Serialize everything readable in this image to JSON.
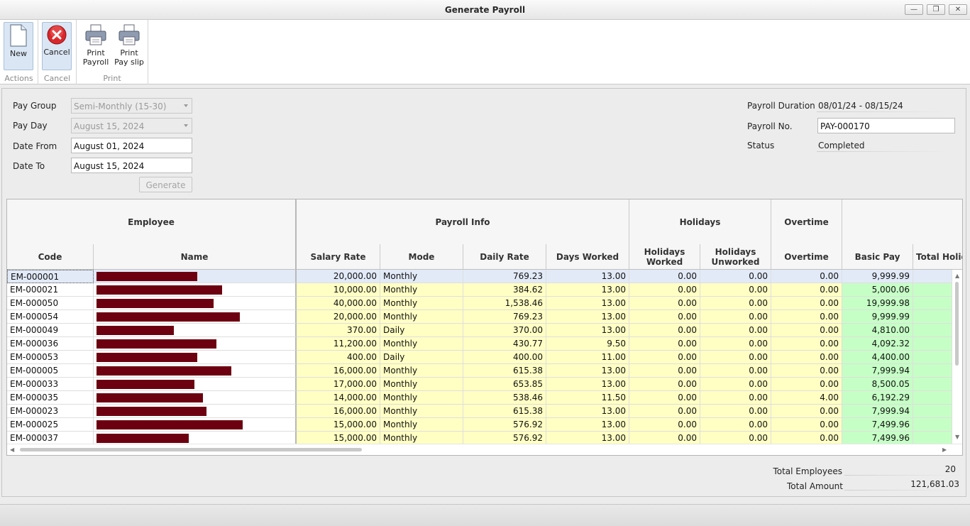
{
  "window": {
    "title": "Generate Payroll"
  },
  "ribbon": {
    "groups": {
      "actions": {
        "caption": "Actions",
        "new_label": "New"
      },
      "cancel": {
        "caption": "Cancel",
        "cancel_label": "Cancel"
      },
      "print": {
        "caption": "Print",
        "print_payroll_label": "Print\nPayroll",
        "print_payslip_label": "Print\nPay slip"
      }
    }
  },
  "form": {
    "pay_group": {
      "label": "Pay Group",
      "value": "Semi-Monthly (15-30)"
    },
    "pay_day": {
      "label": "Pay Day",
      "value": "August 15, 2024"
    },
    "date_from": {
      "label": "Date From",
      "value": "August 01, 2024"
    },
    "date_to": {
      "label": "Date To",
      "value": "August 15, 2024"
    },
    "generate_label": "Generate",
    "payroll_duration": {
      "label": "Payroll Duration",
      "value": "08/01/24 - 08/15/24"
    },
    "payroll_no": {
      "label": "Payroll No.",
      "value": "PAY-000170"
    },
    "status": {
      "label": "Status",
      "value": "Completed"
    }
  },
  "grid": {
    "bands": [
      "Employee",
      "Payroll Info",
      "Holidays",
      "Overtime",
      ""
    ],
    "columns": [
      "Code",
      "Name",
      "Salary Rate",
      "Mode",
      "Daily Rate",
      "Days Worked",
      "Holidays Worked",
      "Holidays\nUnworked",
      "Overtime",
      "Basic Pay",
      "Total Holida"
    ],
    "rows": [
      {
        "code": "EM-000001",
        "salary_rate": "20,000.00",
        "mode": "Monthly",
        "daily_rate": "769.23",
        "days_worked": "13.00",
        "hol_worked": "0.00",
        "hol_unworked": "0.00",
        "overtime": "0.00",
        "basic_pay": "9,999.99",
        "name_len": 0.69
      },
      {
        "code": "EM-000021",
        "salary_rate": "10,000.00",
        "mode": "Monthly",
        "daily_rate": "384.62",
        "days_worked": "13.00",
        "hol_worked": "0.00",
        "hol_unworked": "0.00",
        "overtime": "0.00",
        "basic_pay": "5,000.06",
        "name_len": 0.86
      },
      {
        "code": "EM-000050",
        "salary_rate": "40,000.00",
        "mode": "Monthly",
        "daily_rate": "1,538.46",
        "days_worked": "13.00",
        "hol_worked": "0.00",
        "hol_unworked": "0.00",
        "overtime": "0.00",
        "basic_pay": "19,999.98",
        "name_len": 0.8
      },
      {
        "code": "EM-000054",
        "salary_rate": "20,000.00",
        "mode": "Monthly",
        "daily_rate": "769.23",
        "days_worked": "13.00",
        "hol_worked": "0.00",
        "hol_unworked": "0.00",
        "overtime": "0.00",
        "basic_pay": "9,999.99",
        "name_len": 0.98
      },
      {
        "code": "EM-000049",
        "salary_rate": "370.00",
        "mode": "Daily",
        "daily_rate": "370.00",
        "days_worked": "13.00",
        "hol_worked": "0.00",
        "hol_unworked": "0.00",
        "overtime": "0.00",
        "basic_pay": "4,810.00",
        "name_len": 0.53
      },
      {
        "code": "EM-000036",
        "salary_rate": "11,200.00",
        "mode": "Monthly",
        "daily_rate": "430.77",
        "days_worked": "9.50",
        "hol_worked": "0.00",
        "hol_unworked": "0.00",
        "overtime": "0.00",
        "basic_pay": "4,092.32",
        "name_len": 0.82
      },
      {
        "code": "EM-000053",
        "salary_rate": "400.00",
        "mode": "Daily",
        "daily_rate": "400.00",
        "days_worked": "11.00",
        "hol_worked": "0.00",
        "hol_unworked": "0.00",
        "overtime": "0.00",
        "basic_pay": "4,400.00",
        "name_len": 0.69
      },
      {
        "code": "EM-000005",
        "salary_rate": "16,000.00",
        "mode": "Monthly",
        "daily_rate": "615.38",
        "days_worked": "13.00",
        "hol_worked": "0.00",
        "hol_unworked": "0.00",
        "overtime": "0.00",
        "basic_pay": "7,999.94",
        "name_len": 0.92
      },
      {
        "code": "EM-000033",
        "salary_rate": "17,000.00",
        "mode": "Monthly",
        "daily_rate": "653.85",
        "days_worked": "13.00",
        "hol_worked": "0.00",
        "hol_unworked": "0.00",
        "overtime": "0.00",
        "basic_pay": "8,500.05",
        "name_len": 0.67
      },
      {
        "code": "EM-000035",
        "salary_rate": "14,000.00",
        "mode": "Monthly",
        "daily_rate": "538.46",
        "days_worked": "11.50",
        "hol_worked": "0.00",
        "hol_unworked": "0.00",
        "overtime": "4.00",
        "basic_pay": "6,192.29",
        "name_len": 0.73
      },
      {
        "code": "EM-000023",
        "salary_rate": "16,000.00",
        "mode": "Monthly",
        "daily_rate": "615.38",
        "days_worked": "13.00",
        "hol_worked": "0.00",
        "hol_unworked": "0.00",
        "overtime": "0.00",
        "basic_pay": "7,999.94",
        "name_len": 0.75
      },
      {
        "code": "EM-000025",
        "salary_rate": "15,000.00",
        "mode": "Monthly",
        "daily_rate": "576.92",
        "days_worked": "13.00",
        "hol_worked": "0.00",
        "hol_unworked": "0.00",
        "overtime": "0.00",
        "basic_pay": "7,499.96",
        "name_len": 1.0
      },
      {
        "code": "EM-000037",
        "salary_rate": "15,000.00",
        "mode": "Monthly",
        "daily_rate": "576.92",
        "days_worked": "13.00",
        "hol_worked": "0.00",
        "hol_unworked": "0.00",
        "overtime": "0.00",
        "basic_pay": "7,499.96",
        "name_len": 0.63
      }
    ]
  },
  "totals": {
    "total_employees_label": "Total Employees",
    "total_employees": "20",
    "total_amount_label": "Total Amount",
    "total_amount": "121,681.03"
  },
  "colors": {
    "name_redaction": "#6d0010",
    "payroll_info_bg": "#ffffc4",
    "basic_pay_bg": "#c6ffc6",
    "selected_row": "#e2eaf8"
  }
}
